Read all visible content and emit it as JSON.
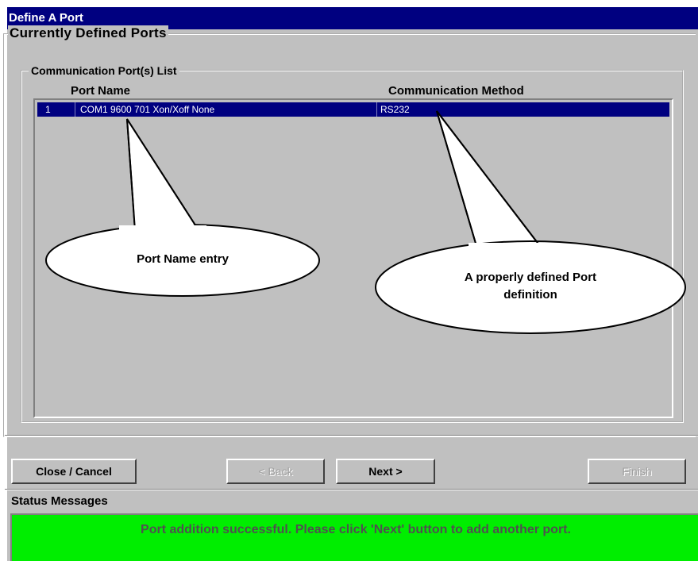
{
  "window": {
    "title": "Define A Port"
  },
  "outer_group": {
    "legend": "Currently Defined Ports"
  },
  "inner_group": {
    "legend": "Communication Port(s) List"
  },
  "list": {
    "columns": [
      "Port Name",
      "Communication Method"
    ],
    "rows": [
      {
        "index": "1",
        "port_name": "COM1 9600 701 Xon/Xoff None",
        "method": "RS232",
        "selected": true
      }
    ]
  },
  "annotations": {
    "port_name_callout": "Port Name entry",
    "port_def_callout_line1": "A properly defined Port",
    "port_def_callout_line2": "definition"
  },
  "buttons": {
    "close": "Close / Cancel",
    "back": "< Back",
    "next": "Next >",
    "finish": "Finish"
  },
  "status": {
    "label": "Status Messages",
    "message": "Port addition successful. Please click 'Next' button to add another port.",
    "color": "#00ee00"
  }
}
